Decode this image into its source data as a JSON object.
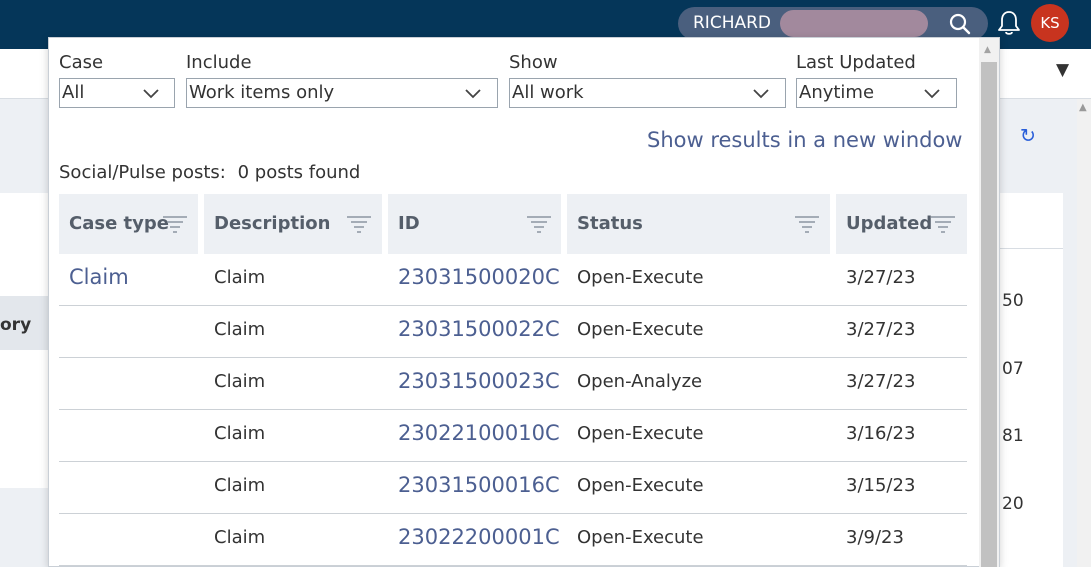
{
  "header": {
    "search_text": "RICHARD",
    "avatar_initials": "KS",
    "colors": {
      "bar": "#053659",
      "avatar": "#c8341f",
      "link": "#4c5f91"
    }
  },
  "background": {
    "label_fragment": "ory",
    "numbers": [
      "50",
      "07",
      "81",
      "20"
    ]
  },
  "filters": {
    "case": {
      "label": "Case",
      "value": "All"
    },
    "include": {
      "label": "Include",
      "value": "Work items only"
    },
    "show": {
      "label": "Show",
      "value": "All work"
    },
    "last_updated": {
      "label": "Last Updated",
      "value": "Anytime"
    }
  },
  "new_window_link": "Show results in a new window",
  "social": {
    "label": "Social/Pulse posts:",
    "count": "0 posts found"
  },
  "table": {
    "columns": [
      "Case type",
      "Description",
      "ID",
      "Status",
      "Updated"
    ],
    "rows": [
      {
        "case_type": "Claim",
        "description": "Claim",
        "id": "23031500020C",
        "status": "Open-Execute",
        "updated": "3/27/23"
      },
      {
        "case_type": "",
        "description": "Claim",
        "id": "23031500022C",
        "status": "Open-Execute",
        "updated": "3/27/23"
      },
      {
        "case_type": "",
        "description": "Claim",
        "id": "23031500023C",
        "status": "Open-Analyze",
        "updated": "3/27/23"
      },
      {
        "case_type": "",
        "description": "Claim",
        "id": "23022100010C",
        "status": "Open-Execute",
        "updated": "3/16/23"
      },
      {
        "case_type": "",
        "description": "Claim",
        "id": "23031500016C",
        "status": "Open-Execute",
        "updated": "3/15/23"
      },
      {
        "case_type": "",
        "description": "Claim",
        "id": "23022200001C",
        "status": "Open-Execute",
        "updated": "3/9/23"
      }
    ]
  },
  "icons": [
    "search-icon",
    "bell-icon",
    "chevron-down-icon",
    "filter-icon",
    "refresh-icon",
    "caret-down-icon"
  ]
}
